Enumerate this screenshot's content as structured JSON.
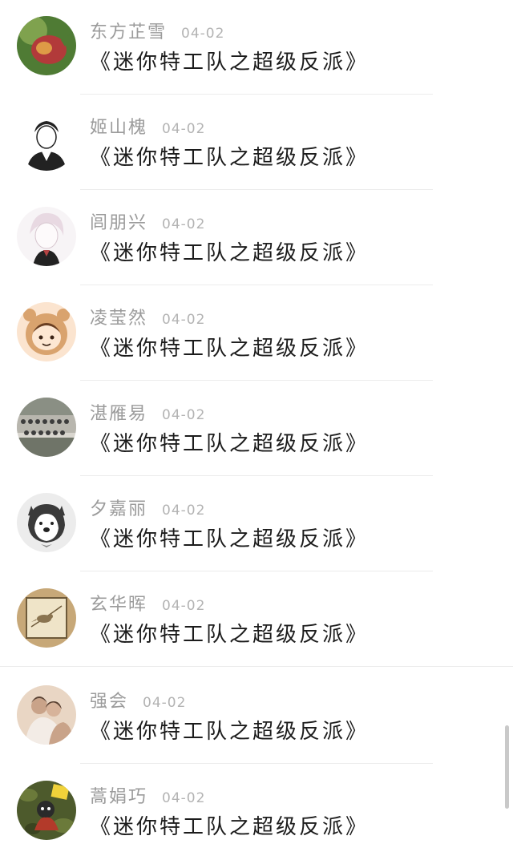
{
  "comments": [
    {
      "name": "东方芷雪",
      "date": "04-02",
      "text": "《迷你特工队之超级反派》",
      "avatar": "dragon-fruit-avatar",
      "colors": [
        "#b23a3a",
        "#e9b44a",
        "#4f7b34"
      ]
    },
    {
      "name": "姬山槐",
      "date": "04-02",
      "text": "《迷你特工队之超级反派》",
      "avatar": "sketch-boy-avatar",
      "colors": [
        "#ffffff",
        "#222222",
        "#555555"
      ]
    },
    {
      "name": "闾朋兴",
      "date": "04-02",
      "text": "《迷你特工队之超级反派》",
      "avatar": "anime-boy-avatar",
      "colors": [
        "#f7f4f6",
        "#e8d9e2",
        "#222222"
      ]
    },
    {
      "name": "凌莹然",
      "date": "04-02",
      "text": "《迷你特工队之超级反派》",
      "avatar": "cartoon-girl-avatar",
      "colors": [
        "#fbe4cf",
        "#d9a36e",
        "#6a3f22"
      ]
    },
    {
      "name": "湛雁易",
      "date": "04-02",
      "text": "《迷你特工队之超级反派》",
      "avatar": "group-photo-avatar",
      "colors": [
        "#d9d6cf",
        "#6f7468",
        "#3d3d3d"
      ]
    },
    {
      "name": "夕嘉丽",
      "date": "04-02",
      "text": "《迷你特工队之超级反派》",
      "avatar": "husky-dog-avatar",
      "colors": [
        "#ececec",
        "#3a3a3a",
        "#ffffff"
      ]
    },
    {
      "name": "玄华晖",
      "date": "04-02",
      "text": "《迷你特工队之超级反派》",
      "avatar": "bird-painting-avatar",
      "colors": [
        "#c7a878",
        "#efe4c8",
        "#6e5a3a"
      ]
    },
    {
      "name": "强会",
      "date": "04-02",
      "text": "《迷你特工队之超级反派》",
      "avatar": "couple-photo-avatar",
      "colors": [
        "#e9d6c4",
        "#c9a389",
        "#5a4233"
      ]
    },
    {
      "name": "蒿娟巧",
      "date": "04-02",
      "text": "《迷你特工队之超级反派》",
      "avatar": "camo-cartoon-avatar",
      "colors": [
        "#4d5a2c",
        "#f0d23a",
        "#2a2a2a"
      ]
    }
  ]
}
